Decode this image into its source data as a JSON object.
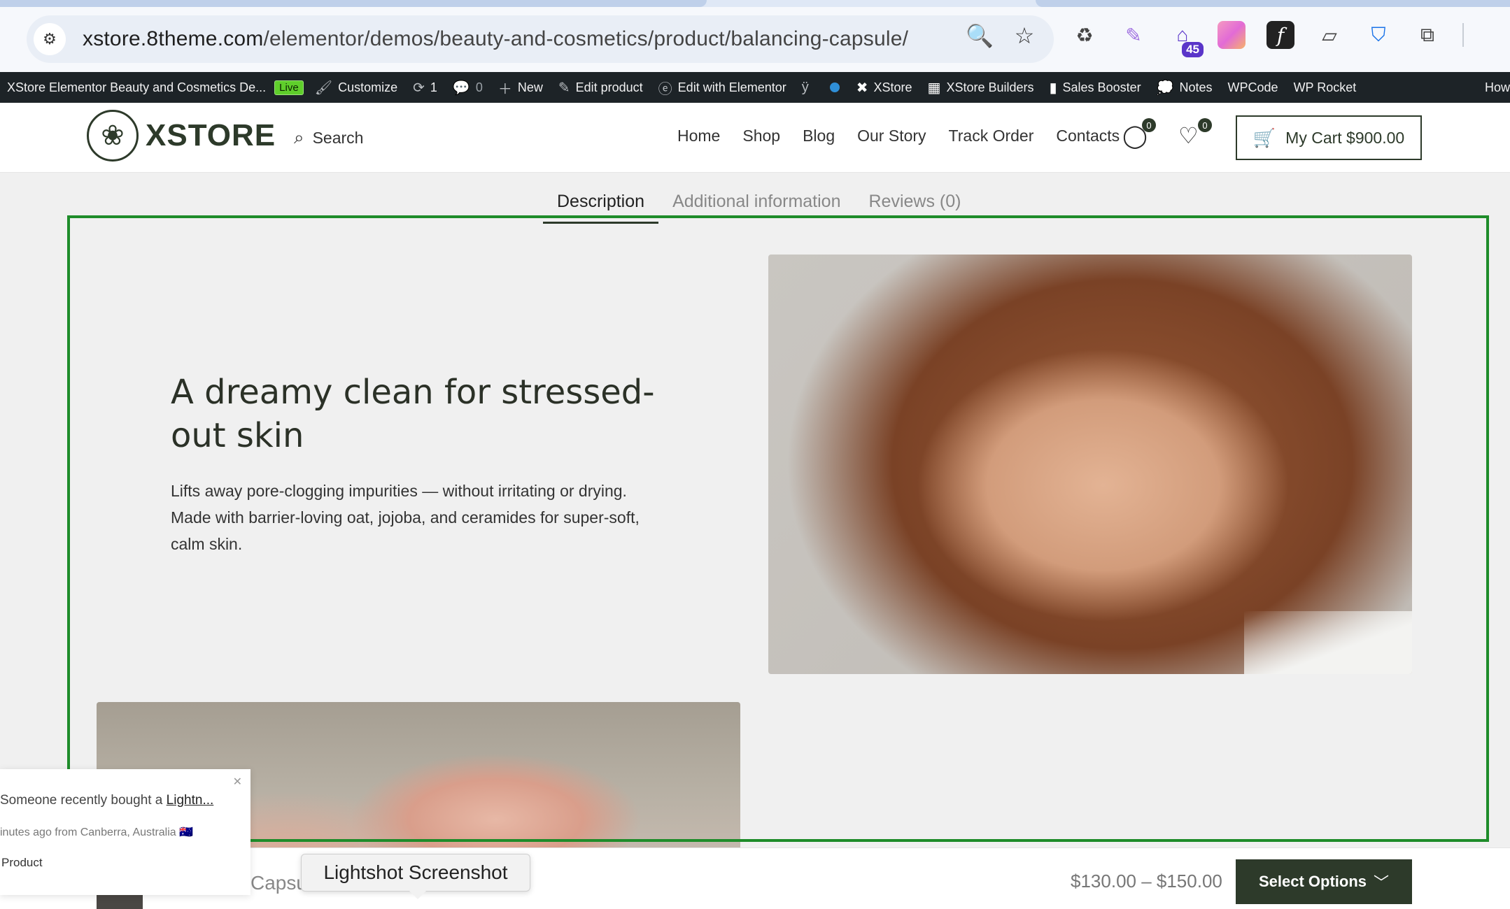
{
  "browser": {
    "url_domain": "xstore.8theme.com",
    "url_path": "/elementor/demos/beauty-and-cosmetics/product/balancing-capsule/",
    "extension_badge": "45"
  },
  "adminbar": {
    "site_name": "XStore Elementor Beauty and Cosmetics De...",
    "live_label": "Live",
    "customize": "Customize",
    "updates_count": "1",
    "comments_count": "0",
    "new_label": "New",
    "edit_product": "Edit product",
    "edit_elementor": "Edit with Elementor",
    "xstore": "XStore",
    "xstore_builders": "XStore Builders",
    "sales_booster": "Sales Booster",
    "notes": "Notes",
    "wpcode": "WPCode",
    "wp_rocket": "WP Rocket",
    "howdy": "How"
  },
  "header": {
    "logo_text": "XSTORE",
    "search_label": "Search",
    "nav": [
      "Home",
      "Shop",
      "Blog",
      "Our Story",
      "Track Order",
      "Contacts"
    ],
    "compare_count": "0",
    "wishlist_count": "0",
    "cart_label": "My Cart $900.00"
  },
  "tabs": [
    "Description",
    "Additional information",
    "Reviews (0)"
  ],
  "content": {
    "headline": "A dreamy clean for stressed-out skin",
    "description": "Lifts away pore-clogging impurities — without irritating or drying. Made with barrier-loving oat, jojoba, and ceramides for super-soft, calm skin."
  },
  "popup": {
    "line1_prefix": "Someone recently bought a ",
    "line1_link": "Lightn...",
    "line2": "inutes ago from Canberra, Australia 🇦🇺",
    "line3": "Product"
  },
  "sticky": {
    "product_name": "Capsu",
    "price": "$130.00 – $150.00",
    "button": "Select Options"
  },
  "tooltip": "Lightshot Screenshot",
  "colors": {
    "brand_dark": "#2d3a2a",
    "highlight_green": "#1e8c2a",
    "admin_bar": "#1d2327"
  }
}
